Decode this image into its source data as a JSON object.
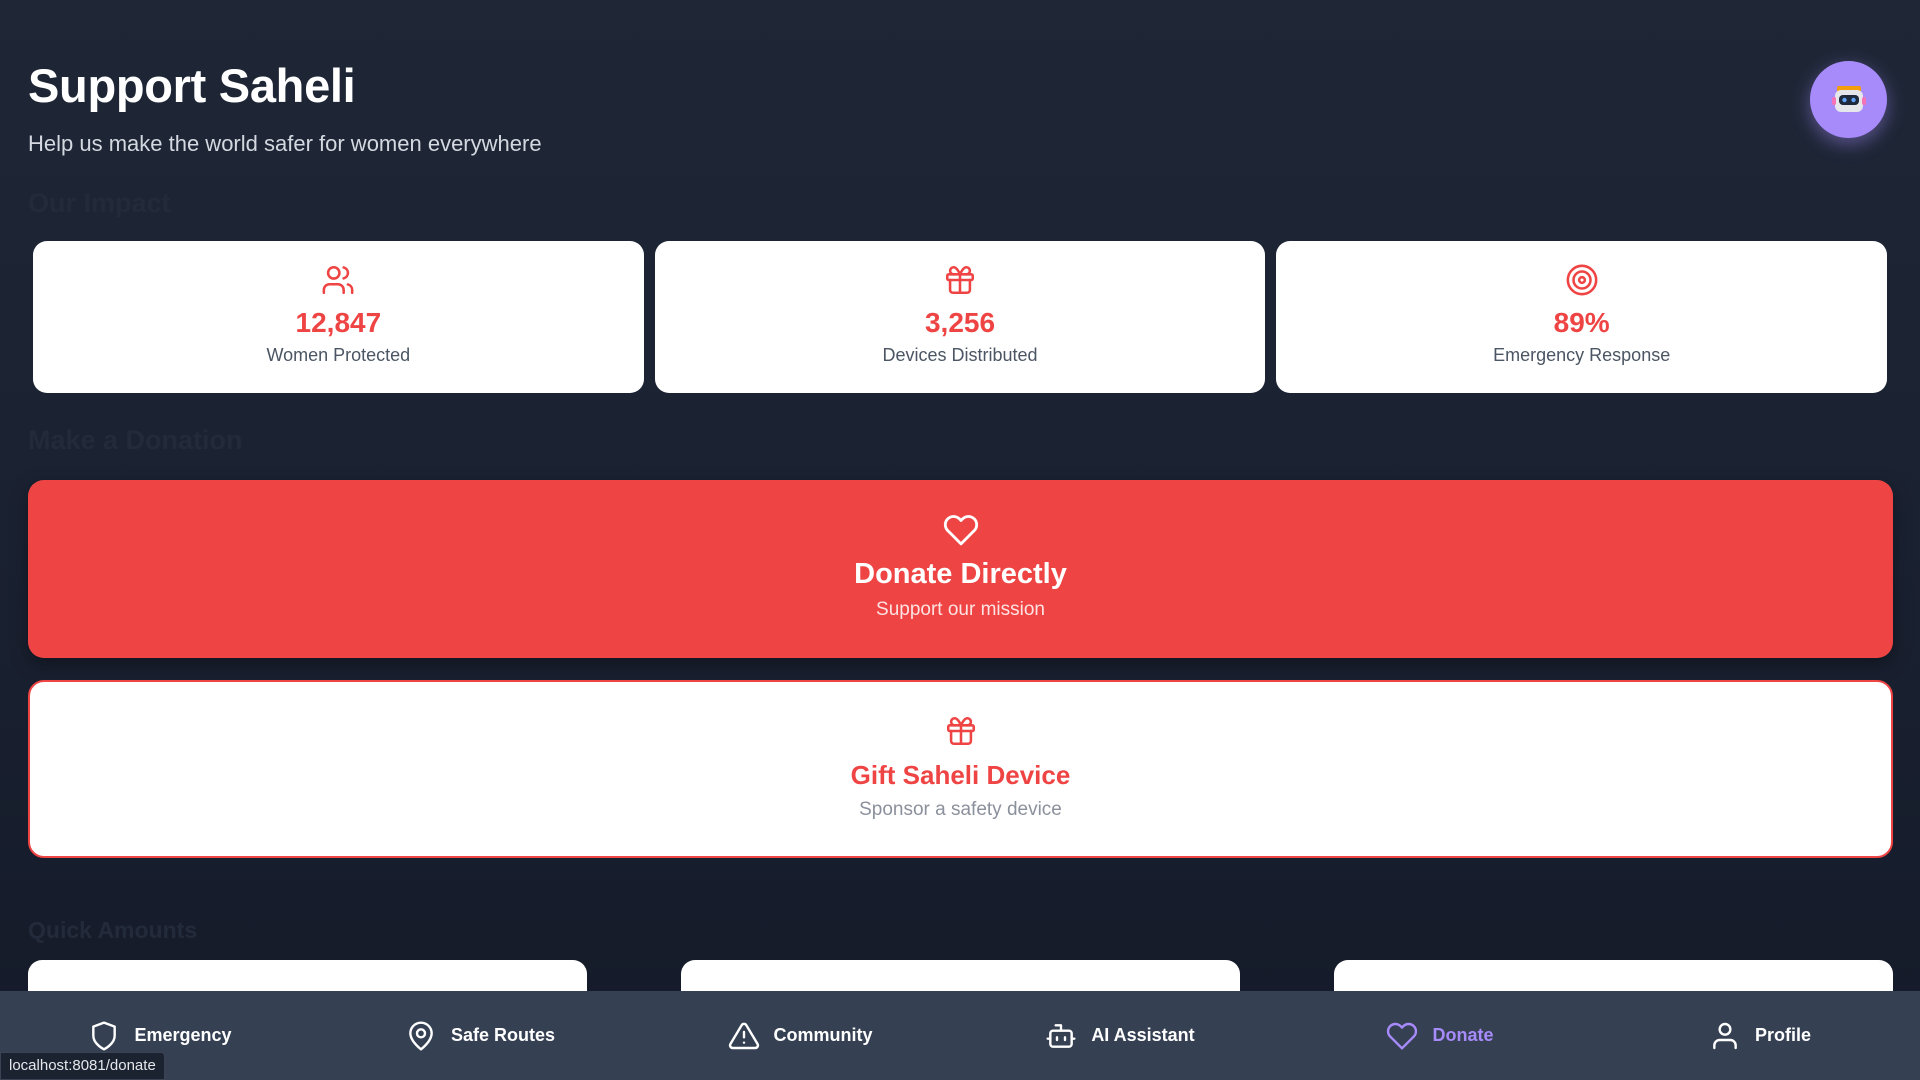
{
  "header": {
    "title": "Support Saheli",
    "subtitle": "Help us make the world safer for women everywhere"
  },
  "sections": {
    "impact": "Our Impact",
    "donation": "Make a Donation",
    "quick_amounts": "Quick Amounts"
  },
  "stats": [
    {
      "icon": "users-icon",
      "value": "12,847",
      "label": "Women Protected"
    },
    {
      "icon": "gift-icon",
      "value": "3,256",
      "label": "Devices Distributed"
    },
    {
      "icon": "target-icon",
      "value": "89%",
      "label": "Emergency Response"
    }
  ],
  "donate_direct": {
    "icon": "heart-icon",
    "title": "Donate Directly",
    "subtitle": "Support our mission"
  },
  "gift_device": {
    "icon": "gift-icon",
    "title": "Gift Saheli Device",
    "subtitle": "Sponsor a safety device"
  },
  "nav": [
    {
      "icon": "shield-icon",
      "label": "Emergency",
      "active": false
    },
    {
      "icon": "map-pin-icon",
      "label": "Safe Routes",
      "active": false
    },
    {
      "icon": "alert-triangle-icon",
      "label": "Community",
      "active": false
    },
    {
      "icon": "bot-icon",
      "label": "AI Assistant",
      "active": false
    },
    {
      "icon": "heart-icon",
      "label": "Donate",
      "active": true
    },
    {
      "icon": "user-icon",
      "label": "Profile",
      "active": false
    }
  ],
  "status_bar": {
    "url": "localhost:8081/donate"
  },
  "colors": {
    "accent": "#ef4444",
    "nav_active": "#a78bfa",
    "nav_bg": "#354053"
  }
}
